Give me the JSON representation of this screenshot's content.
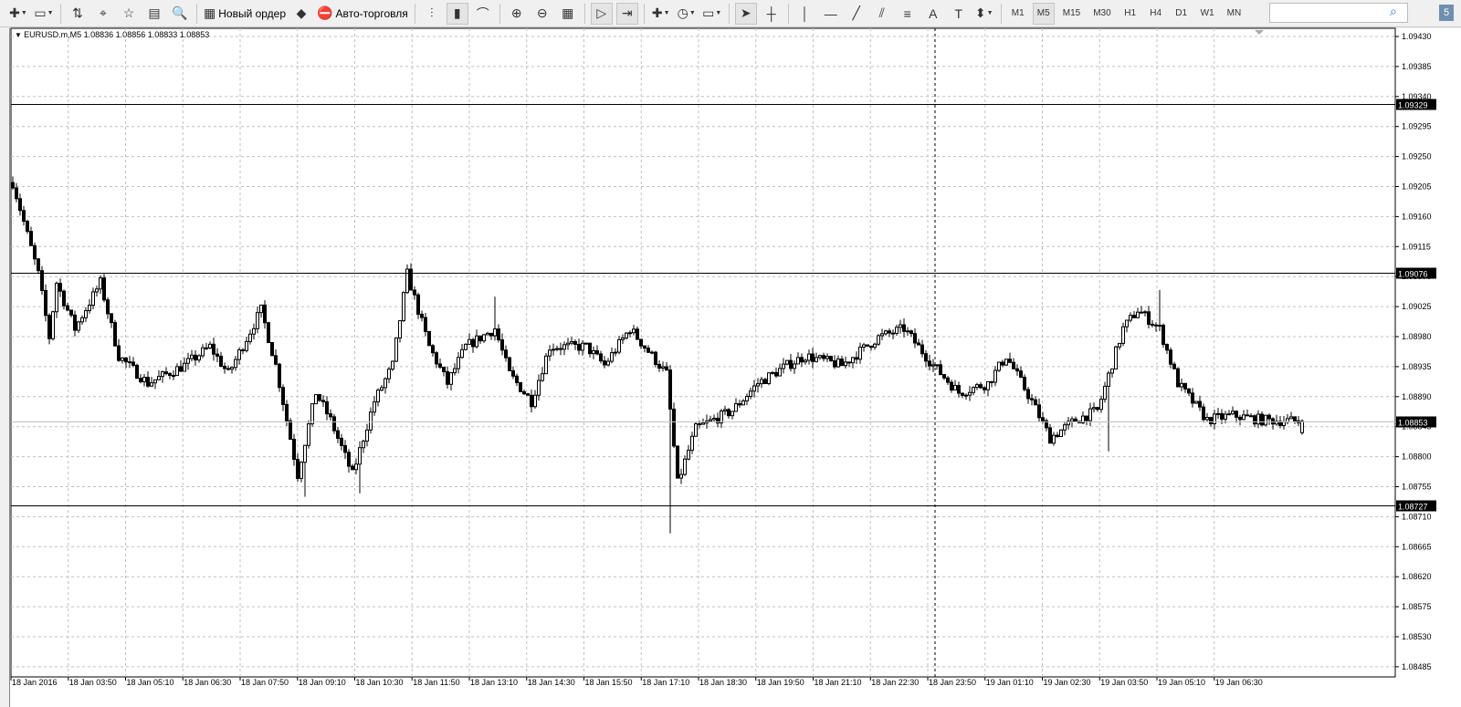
{
  "toolbar": {
    "items": [
      {
        "name": "new-chart-button",
        "icon": "✚",
        "dd": true
      },
      {
        "name": "profiles-button",
        "icon": "▭",
        "dd": true
      },
      {
        "sep": true
      },
      {
        "name": "market-watch-button",
        "icon": "⇅"
      },
      {
        "name": "navigator-button",
        "icon": "⌖"
      },
      {
        "name": "favorites-button",
        "icon": "☆"
      },
      {
        "name": "terminal-button",
        "icon": "▤"
      },
      {
        "name": "strategy-tester-button",
        "icon": "🔍"
      },
      {
        "sep": true
      },
      {
        "name": "new-order-button",
        "icon": "▦",
        "label": "Новый ордер"
      },
      {
        "name": "metaeditor-button",
        "icon": "◆"
      },
      {
        "name": "auto-trading-button",
        "icon": "⛔",
        "label": "Авто-торговля"
      },
      {
        "sep": true
      },
      {
        "name": "bar-chart-button",
        "icon": "⫶"
      },
      {
        "name": "candlestick-button",
        "icon": "▮",
        "active": true
      },
      {
        "name": "line-chart-button",
        "icon": "⌒"
      },
      {
        "sep": true
      },
      {
        "name": "zoom-in-button",
        "icon": "⊕"
      },
      {
        "name": "zoom-out-button",
        "icon": "⊖"
      },
      {
        "name": "tile-windows-button",
        "icon": "▦"
      },
      {
        "sep": true
      },
      {
        "name": "autoscroll-button",
        "icon": "▷",
        "active": true
      },
      {
        "name": "chart-shift-button",
        "icon": "⇥",
        "active": true
      },
      {
        "sep": true
      },
      {
        "name": "indicators-button",
        "icon": "✚",
        "dd": true
      },
      {
        "name": "periods-button",
        "icon": "◷",
        "dd": true
      },
      {
        "name": "templates-button",
        "icon": "▭",
        "dd": true
      },
      {
        "sep": true
      },
      {
        "name": "cursor-button",
        "icon": "➤",
        "active": true
      },
      {
        "name": "crosshair-button",
        "icon": "┼"
      },
      {
        "sep": true
      },
      {
        "name": "vertical-line-button",
        "icon": "│"
      },
      {
        "name": "horizontal-line-button",
        "icon": "—"
      },
      {
        "name": "trendline-button",
        "icon": "╱"
      },
      {
        "name": "equidistant-channel-button",
        "icon": "⫽"
      },
      {
        "name": "fibonacci-button",
        "icon": "≡"
      },
      {
        "name": "text-button",
        "icon": "A"
      },
      {
        "name": "text-label-button",
        "icon": "T"
      },
      {
        "name": "arrows-button",
        "icon": "⬍",
        "dd": true
      },
      {
        "sep": true
      }
    ],
    "timeframes": [
      "M1",
      "M5",
      "M15",
      "M30",
      "H1",
      "H4",
      "D1",
      "W1",
      "MN"
    ],
    "active_timeframe": "M5",
    "search_placeholder": "",
    "badge": "5"
  },
  "chart": {
    "header": "EURUSD.m,M5  1.08836 1.08856 1.08833 1.08853",
    "symbol": "EURUSD.m",
    "timeframe": "M5",
    "ohlc": {
      "open": 1.08836,
      "high": 1.08856,
      "low": 1.08833,
      "close": 1.08853
    },
    "price_labels": [
      "1.09430",
      "1.09385",
      "1.09340",
      "1.09295",
      "1.09250",
      "1.09205",
      "1.09160",
      "1.09115",
      "1.09070",
      "1.09025",
      "1.08980",
      "1.08935",
      "1.08890",
      "1.08845",
      "1.08800",
      "1.08755",
      "1.08710",
      "1.08665",
      "1.08620",
      "1.08575",
      "1.08530",
      "1.08485"
    ],
    "price_max": 1.0943,
    "price_step": 0.00045,
    "time_labels": [
      "18 Jan 2016",
      "18 Jan 03:50",
      "18 Jan 05:10",
      "18 Jan 06:30",
      "18 Jan 07:50",
      "18 Jan 09:10",
      "18 Jan 10:30",
      "18 Jan 11:50",
      "18 Jan 13:10",
      "18 Jan 14:30",
      "18 Jan 15:50",
      "18 Jan 17:10",
      "18 Jan 18:30",
      "18 Jan 19:50",
      "18 Jan 21:10",
      "18 Jan 22:30",
      "18 Jan 23:50",
      "19 Jan 01:10",
      "19 Jan 02:30",
      "19 Jan 03:50",
      "19 Jan 05:10",
      "19 Jan 06:30"
    ],
    "levels": [
      {
        "price": "1.09329",
        "kind": "hline"
      },
      {
        "price": "1.09076",
        "kind": "hline"
      },
      {
        "price": "1.08853",
        "kind": "bid"
      },
      {
        "price": "1.08727",
        "kind": "hline"
      }
    ],
    "close_path": [
      [
        0,
        1.09211
      ],
      [
        7,
        1.09074
      ],
      [
        10,
        1.08979
      ],
      [
        12,
        1.09061
      ],
      [
        17,
        1.08992
      ],
      [
        24,
        1.09061
      ],
      [
        29,
        1.08951
      ],
      [
        37,
        1.0891
      ],
      [
        47,
        1.08937
      ],
      [
        54,
        1.08965
      ],
      [
        59,
        1.08924
      ],
      [
        68,
        1.0902
      ],
      [
        72,
        1.08937
      ],
      [
        78,
        1.08773
      ],
      [
        83,
        1.08896
      ],
      [
        87,
        1.08855
      ],
      [
        93,
        1.08773
      ],
      [
        99,
        1.08883
      ],
      [
        104,
        1.08937
      ],
      [
        108,
        1.09074
      ],
      [
        114,
        1.08965
      ],
      [
        119,
        1.0891
      ],
      [
        124,
        1.08965
      ],
      [
        132,
        1.08992
      ],
      [
        136,
        1.08924
      ],
      [
        142,
        1.08883
      ],
      [
        147,
        1.08965
      ],
      [
        157,
        1.08965
      ],
      [
        162,
        1.08937
      ],
      [
        169,
        1.08992
      ],
      [
        179,
        1.08924
      ],
      [
        182,
        1.0876
      ],
      [
        187,
        1.08842
      ],
      [
        197,
        1.08869
      ],
      [
        204,
        1.0891
      ],
      [
        212,
        1.08937
      ],
      [
        217,
        1.08951
      ],
      [
        227,
        1.08937
      ],
      [
        237,
        1.08979
      ],
      [
        244,
        1.08992
      ],
      [
        252,
        1.08937
      ],
      [
        259,
        1.08896
      ],
      [
        267,
        1.0891
      ],
      [
        272,
        1.08951
      ],
      [
        279,
        1.08883
      ],
      [
        284,
        1.08828
      ],
      [
        291,
        1.08855
      ],
      [
        297,
        1.08869
      ],
      [
        304,
        1.08992
      ],
      [
        308,
        1.0902
      ],
      [
        314,
        1.08992
      ],
      [
        319,
        1.0891
      ],
      [
        327,
        1.08855
      ],
      [
        334,
        1.08862
      ],
      [
        342,
        1.08855
      ],
      [
        353,
        1.08853
      ]
    ],
    "spike_lows": [
      [
        80,
        1.0874
      ],
      [
        95,
        1.08745
      ],
      [
        180,
        1.08685
      ],
      [
        300,
        1.08808
      ]
    ],
    "spike_highs": [
      [
        109,
        1.0909
      ],
      [
        132,
        1.0904
      ],
      [
        314,
        1.0905
      ]
    ]
  }
}
